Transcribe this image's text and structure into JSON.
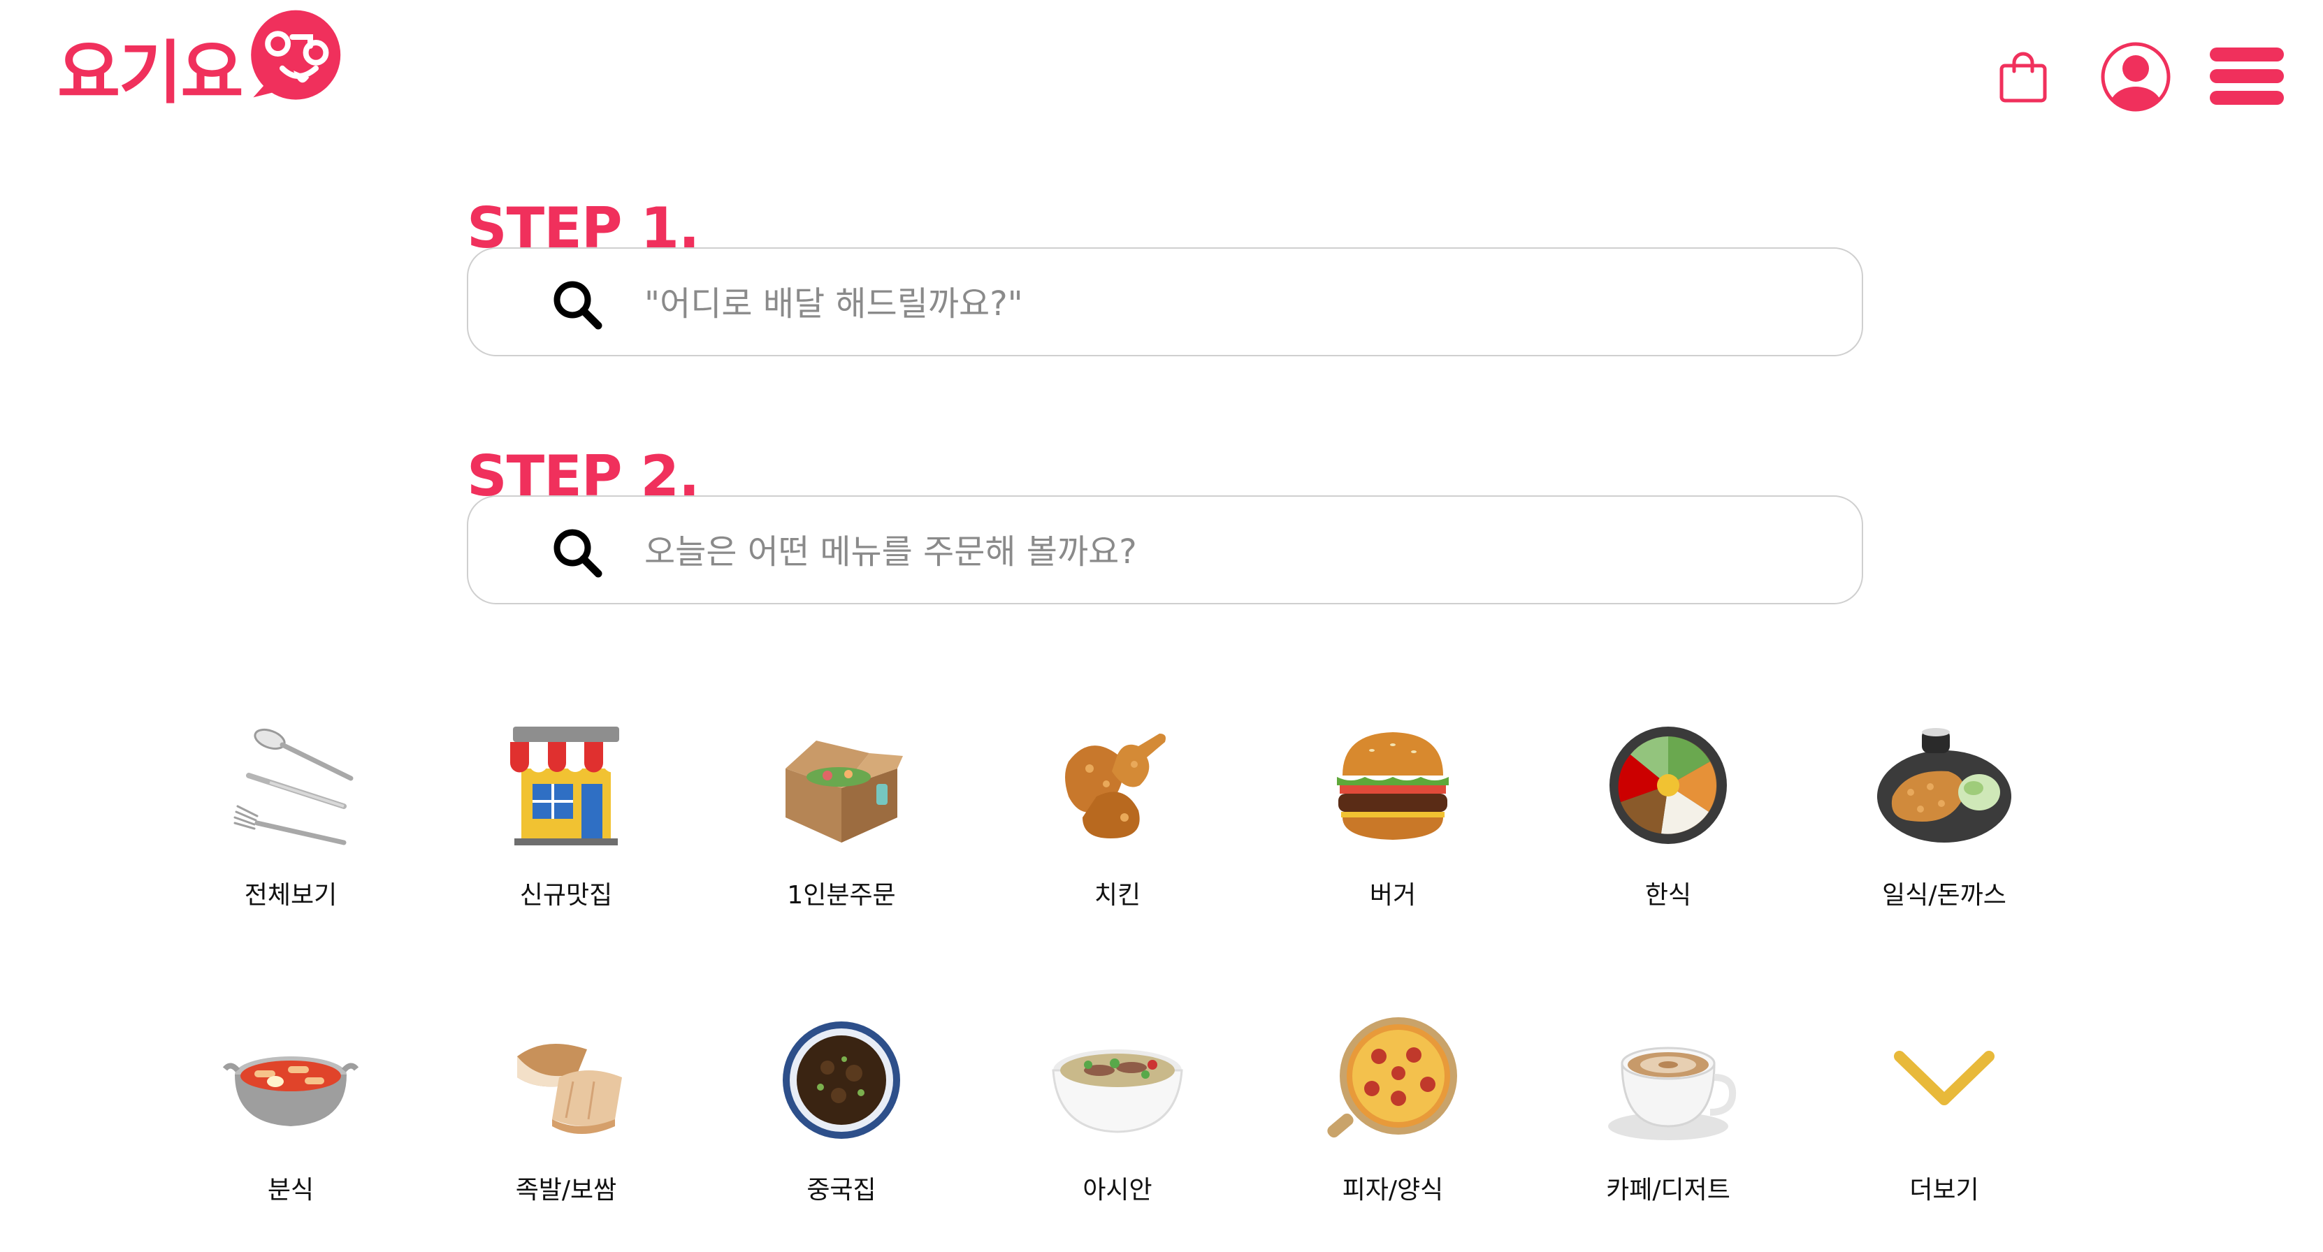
{
  "header": {
    "logo_text": "요기요",
    "brand_color": "#f0305c",
    "icons": [
      "shopping-bag-icon",
      "user-icon",
      "hamburger-menu-icon"
    ]
  },
  "steps": [
    {
      "label": "STEP 1.",
      "placeholder": "\"어디로 배달 해드릴까요?\"",
      "value": ""
    },
    {
      "label": "STEP 2.",
      "placeholder": "오늘은 어떤 메뉴를 주문해 볼까요?",
      "value": ""
    }
  ],
  "categories": {
    "row1": [
      {
        "label": "전체보기",
        "icon": "cutlery-icon"
      },
      {
        "label": "신규맛집",
        "icon": "storefront-icon"
      },
      {
        "label": "1인분주문",
        "icon": "takeout-box-icon"
      },
      {
        "label": "치킨",
        "icon": "fried-chicken-icon"
      },
      {
        "label": "버거",
        "icon": "burger-icon"
      },
      {
        "label": "한식",
        "icon": "bibimbap-icon"
      },
      {
        "label": "일식/돈까스",
        "icon": "tonkatsu-icon"
      }
    ],
    "row2": [
      {
        "label": "분식",
        "icon": "tteokbokki-icon"
      },
      {
        "label": "족발/보쌈",
        "icon": "jokbal-icon"
      },
      {
        "label": "중국집",
        "icon": "chinese-food-icon"
      },
      {
        "label": "아시안",
        "icon": "pho-icon"
      },
      {
        "label": "피자/양식",
        "icon": "pizza-icon"
      },
      {
        "label": "카페/디저트",
        "icon": "coffee-icon"
      },
      {
        "label": "더보기",
        "icon": "chevron-down-icon"
      }
    ]
  },
  "colors": {
    "accent": "#f0305c",
    "more_chevron": "#e8b93a",
    "border": "#cfcfcf",
    "placeholder": "#8a8a8a"
  }
}
